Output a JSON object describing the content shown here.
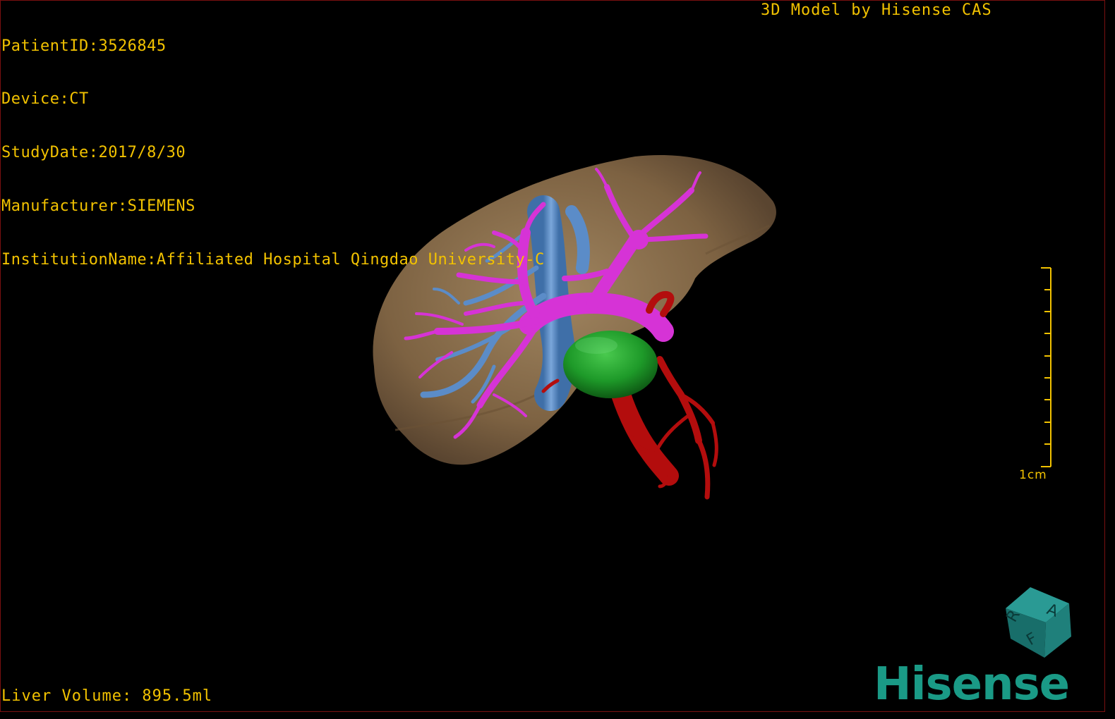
{
  "overlay": {
    "patient_id": "PatientID:3526845",
    "device": "Device:CT",
    "study_date": "StudyDate:2017/8/30",
    "manufacturer": "Manufacturer:SIEMENS",
    "institution": "InstitutionName:Affiliated Hospital Qingdao University-C",
    "model_credit": "3D Model by Hisense CAS",
    "liver_volume": "Liver Volume: 895.5ml"
  },
  "scale_bar": {
    "label": "1cm",
    "color": "#f2c200"
  },
  "orientation_cube": {
    "letters": [
      "A",
      "R",
      "F"
    ],
    "color": "#1a7f7a"
  },
  "brand": {
    "logo_text": "Hisense",
    "color": "#1a9a86"
  },
  "colors": {
    "liver": "#8a6d4a",
    "portal_vein": "#d633d6",
    "hepatic_vein": "#5b8cc8",
    "arteries": "#b30d0d",
    "tumor": "#1f9a2a",
    "text": "#f2c200"
  }
}
